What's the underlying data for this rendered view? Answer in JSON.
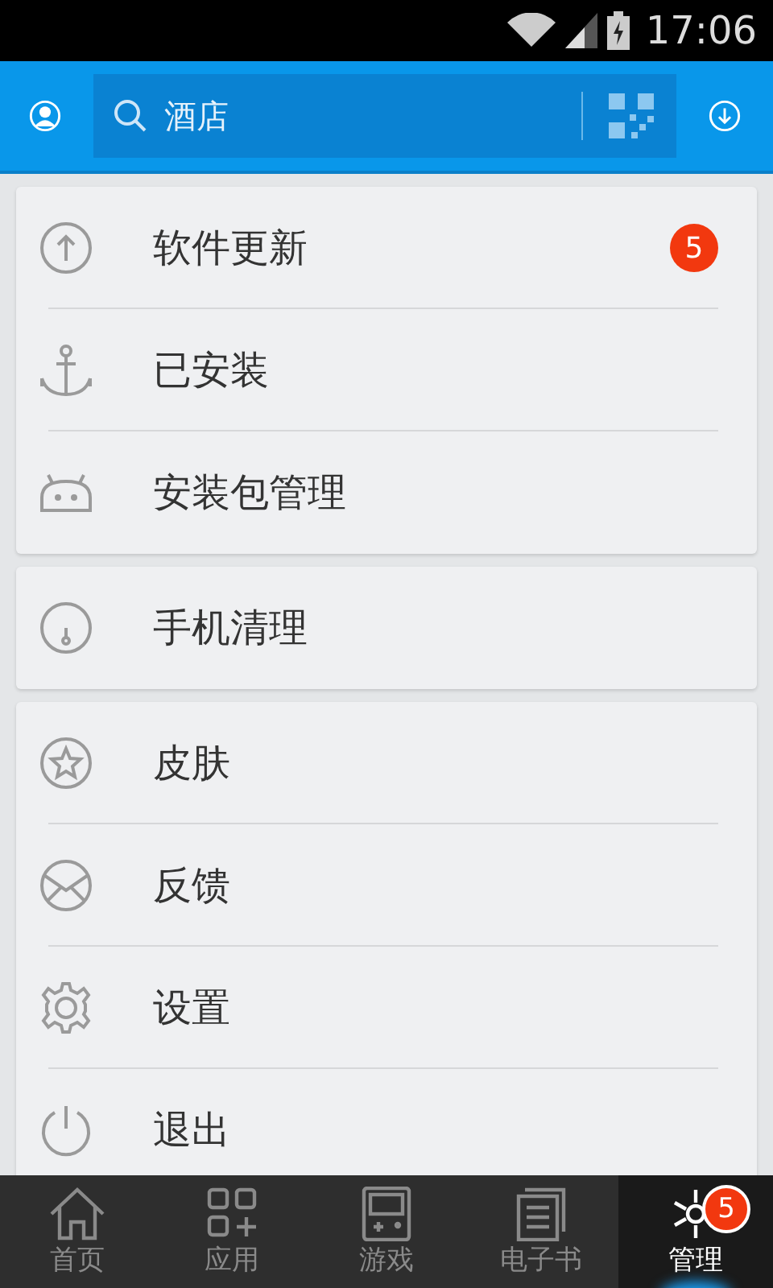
{
  "status_bar": {
    "time": "17:06"
  },
  "search": {
    "placeholder": "酒店"
  },
  "sections": [
    {
      "items": [
        {
          "label": "软件更新",
          "badge": "5"
        },
        {
          "label": "已安装"
        },
        {
          "label": "安装包管理"
        }
      ]
    },
    {
      "items": [
        {
          "label": "手机清理"
        }
      ]
    },
    {
      "items": [
        {
          "label": "皮肤"
        },
        {
          "label": "反馈"
        },
        {
          "label": "设置"
        },
        {
          "label": "退出"
        }
      ]
    }
  ],
  "tabs": [
    {
      "label": "首页",
      "selected": false
    },
    {
      "label": "应用",
      "selected": false
    },
    {
      "label": "游戏",
      "selected": false
    },
    {
      "label": "电子书",
      "selected": false
    },
    {
      "label": "管理",
      "selected": true,
      "badge": "5"
    }
  ]
}
